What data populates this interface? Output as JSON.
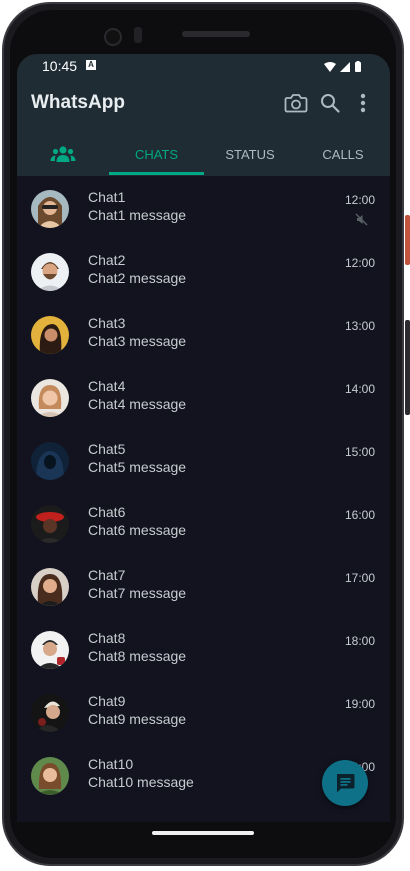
{
  "status_bar": {
    "time": "10:45",
    "notif_icon": "a-icon"
  },
  "app": {
    "title": "WhatsApp"
  },
  "toolbar": {
    "icons": [
      "camera-icon",
      "search-icon",
      "more-vert-icon"
    ]
  },
  "tabs": [
    {
      "label": "",
      "icon": "community-icon"
    },
    {
      "label": "CHATS",
      "active": true
    },
    {
      "label": "STATUS"
    },
    {
      "label": "CALLS"
    }
  ],
  "colors": {
    "accent": "#00a884",
    "header": "#1f2c34",
    "background": "#12131f",
    "fab": "#0e7187"
  },
  "chats": [
    {
      "name": "Chat1",
      "message": "Chat1 message",
      "time": "12:00",
      "muted": true
    },
    {
      "name": "Chat2",
      "message": "Chat2 message",
      "time": "12:00"
    },
    {
      "name": "Chat3",
      "message": "Chat3 message",
      "time": "13:00"
    },
    {
      "name": "Chat4",
      "message": "Chat4 message",
      "time": "14:00"
    },
    {
      "name": "Chat5",
      "message": "Chat5 message",
      "time": "15:00"
    },
    {
      "name": "Chat6",
      "message": "Chat6 message",
      "time": "16:00"
    },
    {
      "name": "Chat7",
      "message": "Chat7 message",
      "time": "17:00"
    },
    {
      "name": "Chat8",
      "message": "Chat8 message",
      "time": "18:00"
    },
    {
      "name": "Chat9",
      "message": "Chat9 message",
      "time": "19:00"
    },
    {
      "name": "Chat10",
      "message": "Chat10 message",
      "time": "110:00"
    }
  ],
  "fab": {
    "icon": "new-chat-icon"
  }
}
